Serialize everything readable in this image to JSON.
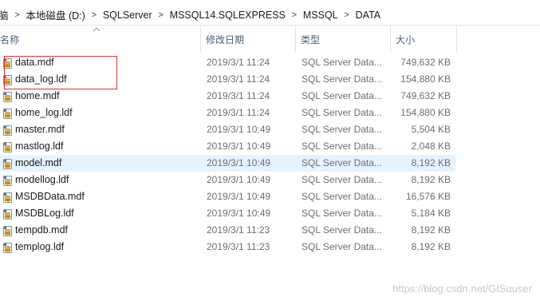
{
  "breadcrumb": {
    "items": [
      "脑",
      "本地磁盘 (D:)",
      "SQLServer",
      "MSSQL14.SQLEXPRESS",
      "MSSQL",
      "DATA"
    ],
    "separator": ">"
  },
  "columns": {
    "name": "名称",
    "date": "修改日期",
    "type": "类型",
    "size": "大小"
  },
  "files": [
    {
      "name": "data.mdf",
      "date": "2019/3/1 11:24",
      "type": "SQL Server Data...",
      "size": "749,632 KB"
    },
    {
      "name": "data_log.ldf",
      "date": "2019/3/1 11:24",
      "type": "SQL Server Data...",
      "size": "154,880 KB"
    },
    {
      "name": "home.mdf",
      "date": "2019/3/1 11:24",
      "type": "SQL Server Data...",
      "size": "749,632 KB"
    },
    {
      "name": "home_log.ldf",
      "date": "2019/3/1 11:24",
      "type": "SQL Server Data...",
      "size": "154,880 KB"
    },
    {
      "name": "master.mdf",
      "date": "2019/3/1 10:49",
      "type": "SQL Server Data...",
      "size": "5,504 KB"
    },
    {
      "name": "mastlog.ldf",
      "date": "2019/3/1 10:49",
      "type": "SQL Server Data...",
      "size": "2,048 KB"
    },
    {
      "name": "model.mdf",
      "date": "2019/3/1 10:49",
      "type": "SQL Server Data...",
      "size": "8,192 KB",
      "hover": true
    },
    {
      "name": "modellog.ldf",
      "date": "2019/3/1 10:49",
      "type": "SQL Server Data...",
      "size": "8,192 KB"
    },
    {
      "name": "MSDBData.mdf",
      "date": "2019/3/1 10:49",
      "type": "SQL Server Data...",
      "size": "16,576 KB"
    },
    {
      "name": "MSDBLog.ldf",
      "date": "2019/3/1 10:49",
      "type": "SQL Server Data...",
      "size": "5,184 KB"
    },
    {
      "name": "tempdb.mdf",
      "date": "2019/3/1 11:23",
      "type": "SQL Server Data...",
      "size": "8,192 KB"
    },
    {
      "name": "templog.ldf",
      "date": "2019/3/1 11:23",
      "type": "SQL Server Data...",
      "size": "8,192 KB"
    }
  ],
  "watermark": "https://blog.csdn.net/GISuuser",
  "colors": {
    "hover_row": "#e5f3ff",
    "highlight_border": "#d9342b",
    "header_text": "#4c607a"
  },
  "icons": {
    "file": "sql-database-file-icon",
    "sort": "sort-ascending-icon"
  }
}
